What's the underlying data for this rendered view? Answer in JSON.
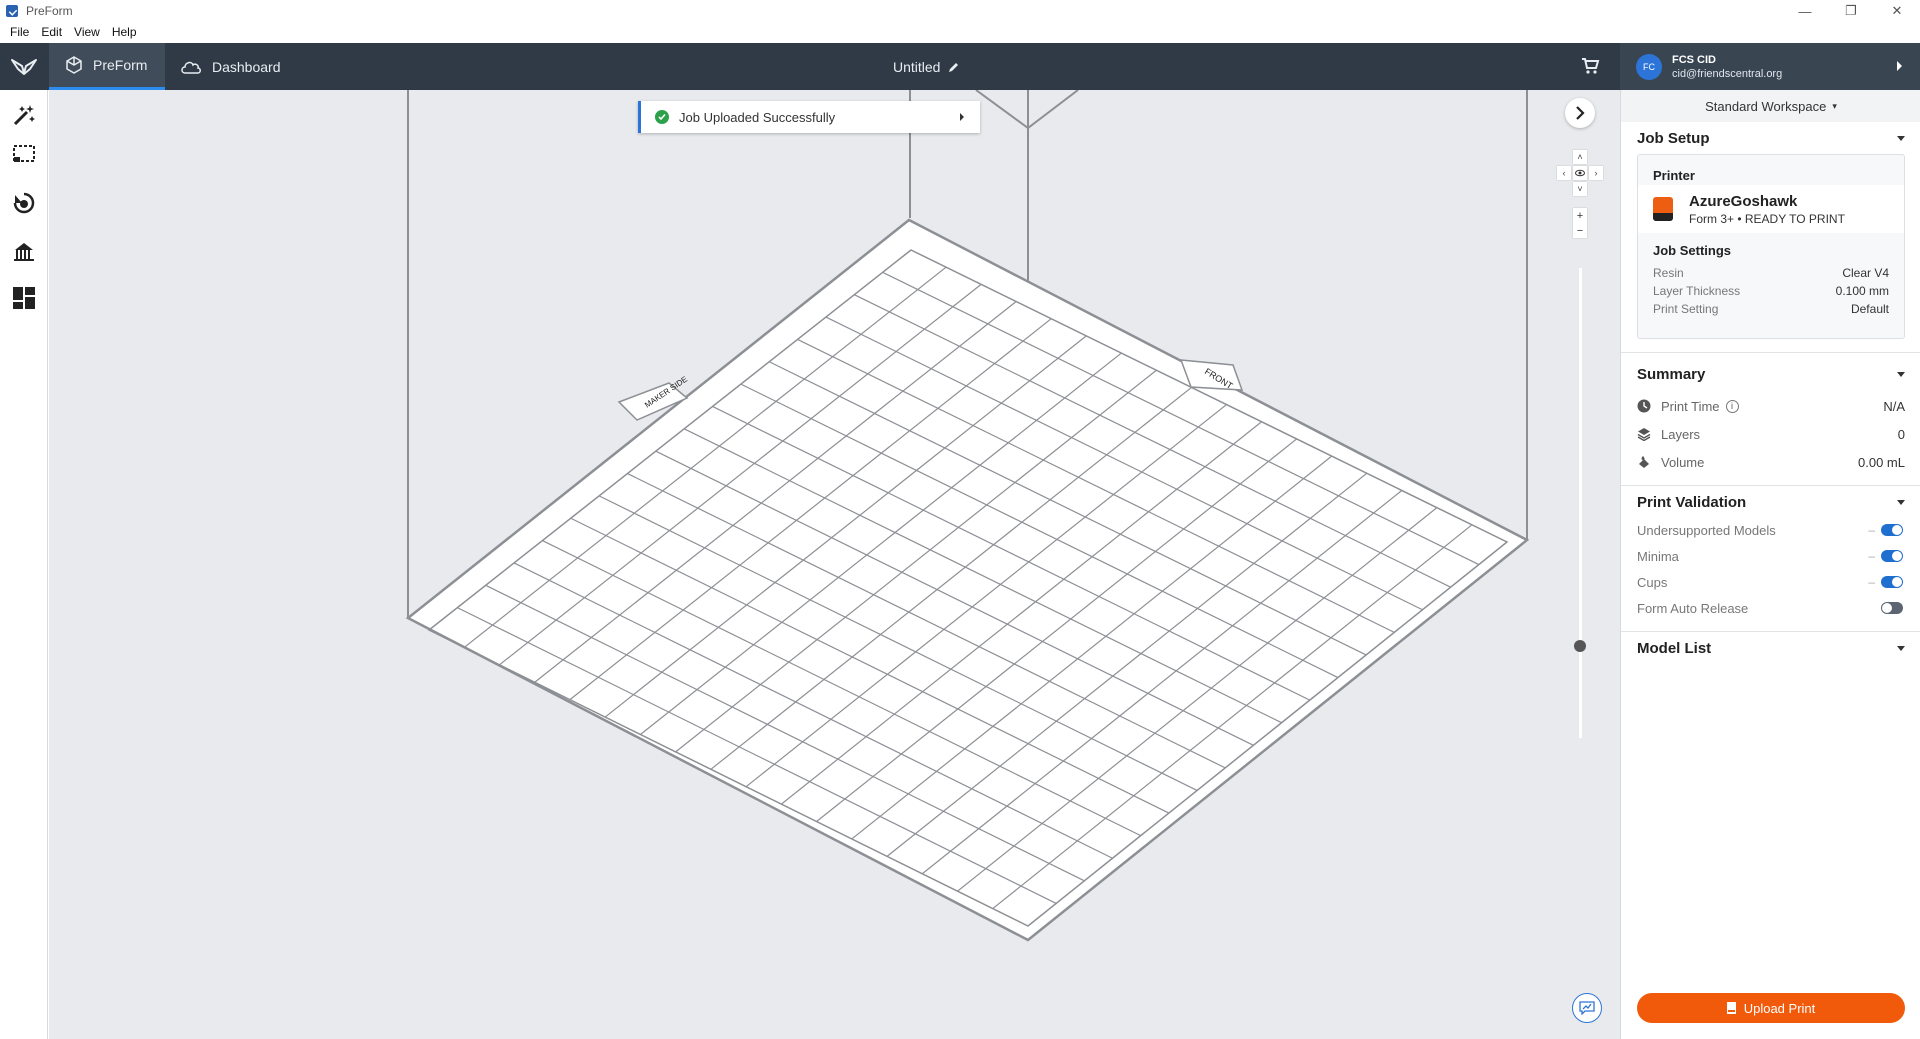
{
  "window": {
    "title": "PreForm",
    "controls": [
      "—",
      "❐",
      "✕"
    ]
  },
  "menu": [
    "File",
    "Edit",
    "View",
    "Help"
  ],
  "nav": {
    "preform_label": "PreForm",
    "dashboard_label": "Dashboard",
    "document_title": "Untitled"
  },
  "account": {
    "initials": "FC",
    "name": "FCS CID",
    "email": "cid@friendscentral.org"
  },
  "left_tools": [
    "magic-wand-icon",
    "select-region-icon",
    "orientation-icon",
    "supports-icon",
    "layout-icon"
  ],
  "viewport": {
    "toast_message": "Job Uploaded Successfully",
    "plate_labels": {
      "left": "MAKER SIDE",
      "right": "FRONT"
    },
    "zoom_in": "+",
    "zoom_out": "−"
  },
  "panel": {
    "workspace": "Standard Workspace",
    "job_setup": {
      "title": "Job Setup",
      "printer_label": "Printer",
      "printer_name": "AzureGoshawk",
      "printer_status": "Form 3+ • READY TO PRINT",
      "job_settings_label": "Job Settings",
      "settings": [
        {
          "label": "Resin",
          "value": "Clear V4"
        },
        {
          "label": "Layer Thickness",
          "value": "0.100 mm"
        },
        {
          "label": "Print Setting",
          "value": "Default"
        }
      ]
    },
    "summary": {
      "title": "Summary",
      "rows": [
        {
          "label": "Print Time",
          "value": "N/A",
          "icon": "clock-icon"
        },
        {
          "label": "Layers",
          "value": "0",
          "icon": "layers-icon"
        },
        {
          "label": "Volume",
          "value": "0.00 mL",
          "icon": "resin-drop-icon"
        }
      ]
    },
    "validation": {
      "title": "Print Validation",
      "rows": [
        {
          "label": "Undersupported Models",
          "dash": "–",
          "on": true
        },
        {
          "label": "Minima",
          "dash": "–",
          "on": true
        },
        {
          "label": "Cups",
          "dash": "–",
          "on": true
        },
        {
          "label": "Form Auto Release",
          "dash": "",
          "on": false
        }
      ]
    },
    "model_list": {
      "title": "Model List"
    },
    "upload_button": "Upload Print"
  }
}
